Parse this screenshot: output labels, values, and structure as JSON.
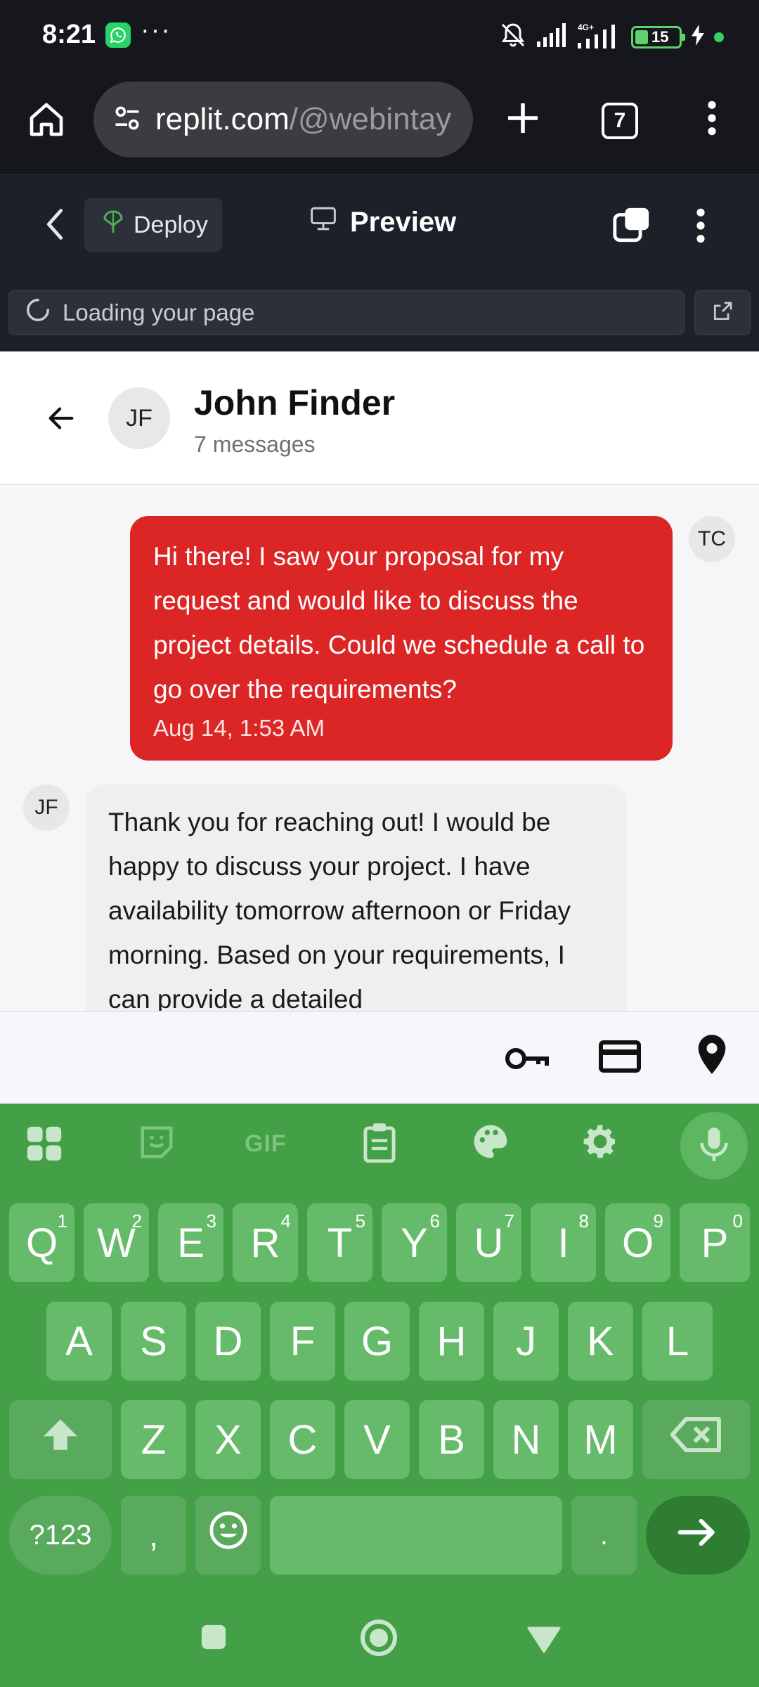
{
  "status_bar": {
    "time": "8:21",
    "overflow": "···",
    "battery": "15",
    "icons": [
      "whatsapp-icon",
      "mute-icon",
      "signal-icon",
      "4g-signal-icon",
      "battery-icon",
      "charging-icon"
    ]
  },
  "browser": {
    "url_host": "replit.com",
    "url_path": "/@webintay",
    "tab_count": "7",
    "icons": [
      "home-icon",
      "site-settings-icon",
      "new-tab-icon",
      "menu-icon"
    ]
  },
  "replit": {
    "deploy_label": "Deploy",
    "preview_label": "Preview",
    "loading_text": "Loading your page"
  },
  "chat": {
    "contact_name": "John Finder",
    "contact_initials": "JF",
    "message_count": "7 messages",
    "messages": [
      {
        "sender_initials": "TC",
        "text": "Hi there! I saw your proposal for my request and would like to discuss the project details. Could we schedule a call to go over the requirements?",
        "time": "Aug 14, 1:53 AM",
        "outgoing": true
      },
      {
        "sender_initials": "JF",
        "text": "Thank you for reaching out! I would be happy to discuss your project. I have availability tomorrow afternoon or Friday morning. Based on your requirements, I can provide a detailed",
        "outgoing": false
      }
    ]
  },
  "keyboard": {
    "accent_color": "#43a047",
    "toolbar_gif": "GIF",
    "row1": [
      {
        "k": "Q",
        "n": "1"
      },
      {
        "k": "W",
        "n": "2"
      },
      {
        "k": "E",
        "n": "3"
      },
      {
        "k": "R",
        "n": "4"
      },
      {
        "k": "T",
        "n": "5"
      },
      {
        "k": "Y",
        "n": "6"
      },
      {
        "k": "U",
        "n": "7"
      },
      {
        "k": "I",
        "n": "8"
      },
      {
        "k": "O",
        "n": "9"
      },
      {
        "k": "P",
        "n": "0"
      }
    ],
    "row2": [
      "A",
      "S",
      "D",
      "F",
      "G",
      "H",
      "J",
      "K",
      "L"
    ],
    "row3": [
      "Z",
      "X",
      "C",
      "V",
      "B",
      "N",
      "M"
    ],
    "sym_label": "?123",
    "comma": ",",
    "period": "."
  }
}
